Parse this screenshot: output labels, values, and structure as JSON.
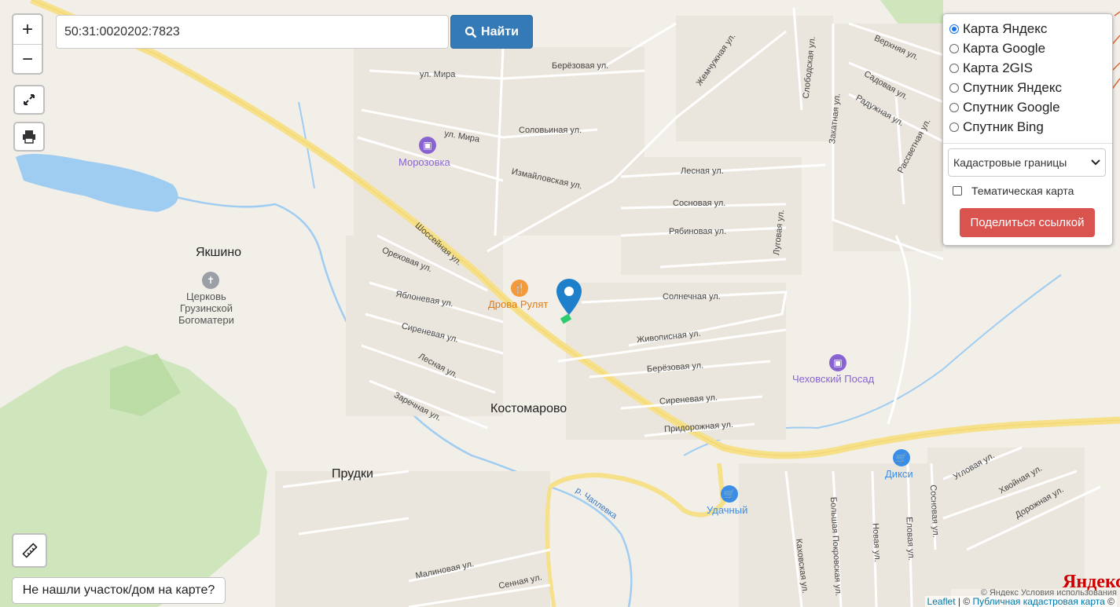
{
  "search": {
    "value": "50:31:0020202:7823",
    "button_label": "Найти"
  },
  "zoom": {
    "in_label": "+",
    "out_label": "−"
  },
  "icons": {
    "fullscreen": "fullscreen-icon",
    "print": "print-icon",
    "ruler": "ruler-icon",
    "search": "search-icon"
  },
  "layers": {
    "options": [
      "Карта Яндекс",
      "Карта Google",
      "Карта 2GIS",
      "Спутник Яндекс",
      "Спутник Google",
      "Спутник Bing"
    ],
    "selected": "Карта Яндекс",
    "cadastral_select": "Кадастровые границы",
    "thematic_label": "Тематическая карта",
    "share_label": "Поделиться ссылкой"
  },
  "not_found_label": "Не нашли участок/дом на карте?",
  "map": {
    "places": [
      "Якшино",
      "Костомарово",
      "Прудки"
    ],
    "pois": [
      "Морозовка",
      "Дрова Рулят",
      "Чеховский Посад",
      "Дикси",
      "Удачный"
    ],
    "church": [
      "Церковь",
      "Грузинской",
      "Богоматери"
    ],
    "streets": [
      "ул. Мира",
      "Берёзовая ул.",
      "Соловьиная ул.",
      "Измайловская ул.",
      "Шоссейная ул.",
      "Ореховая ул.",
      "Яблоневая ул.",
      "Сиреневая ул.",
      "Лесная ул.",
      "Заречная ул.",
      "Лесная ул.",
      "Сосновая ул.",
      "Рябиновая ул.",
      "Луговая ул.",
      "Солнечная ул.",
      "Живописная ул.",
      "Берёзовая ул.",
      "Сиреневая ул.",
      "Придорожная ул.",
      "Жемчужная ул.",
      "Слободская ул.",
      "Верхняя ул.",
      "Садовая ул.",
      "Радужная ул.",
      "Закатная ул.",
      "Рассветная ул.",
      "Угловая ул.",
      "Хвойная ул.",
      "Дорожная ул.",
      "Большая Покровская ул.",
      "Новая ул.",
      "Еловая ул.",
      "Сосновая ул.",
      "Каховская ул.",
      "Малиновая ул.",
      "Сенная ул.",
      "р. Чаплевка",
      "ул. Мира"
    ],
    "logo": "Яндекс",
    "copyright": "© Яндекс Условия использования",
    "attribution_leaflet": "Leaflet",
    "attribution_pkk": "Публичная кадастровая карта",
    "attribution_suffix": " | © ",
    "attribution_end": " ©"
  },
  "colors": {
    "accent": "#337ab7",
    "danger": "#d9534f",
    "marker": "#1e7fcb",
    "road": "#f7e08a",
    "water": "#9fcdf2",
    "forest": "#c8e3b4"
  }
}
